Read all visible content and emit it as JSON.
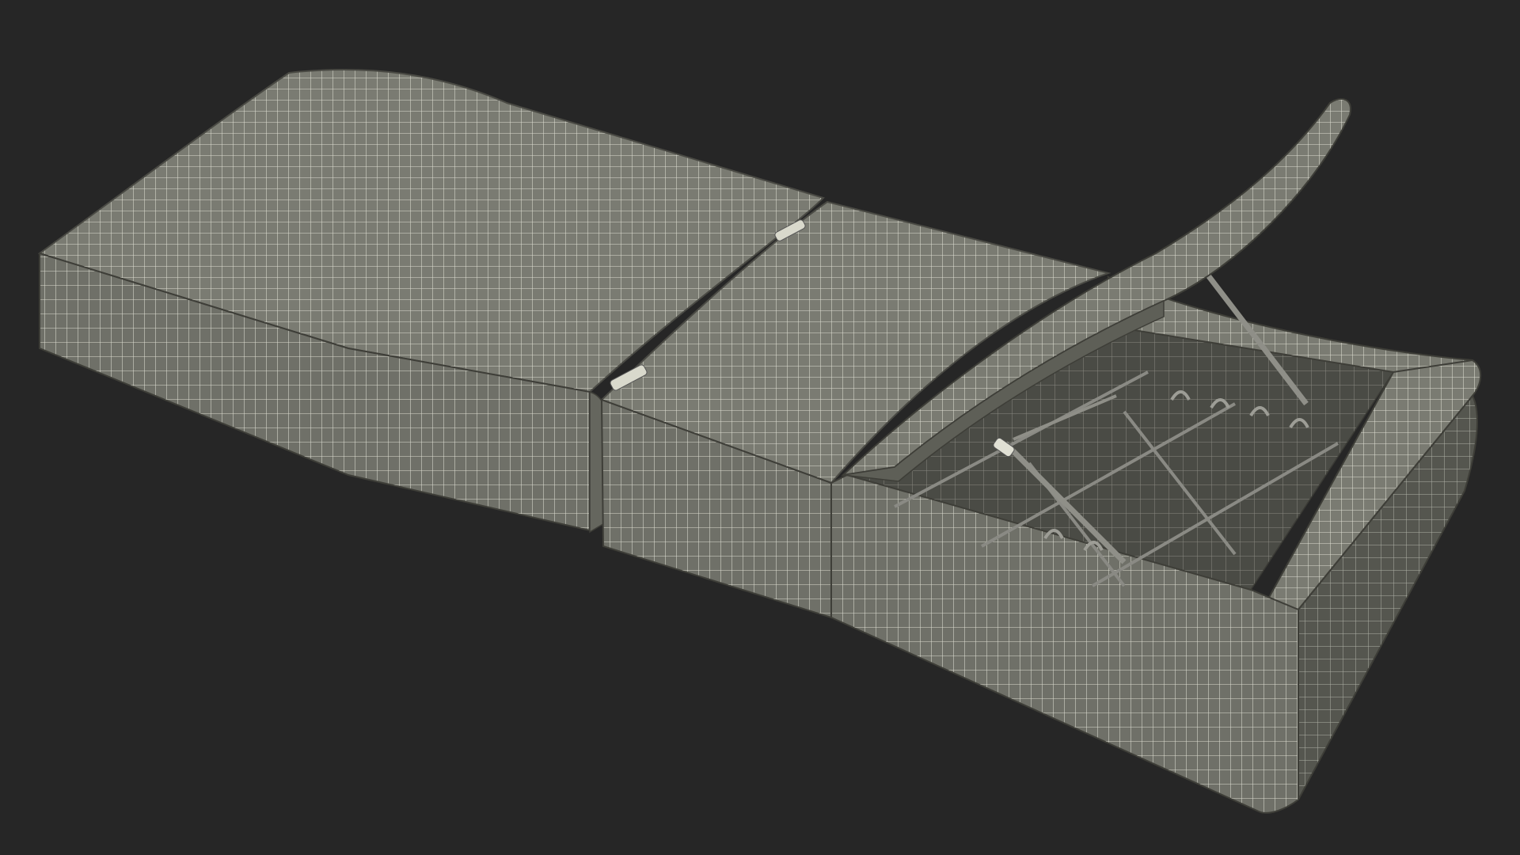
{
  "viewport": {
    "background": "#262626"
  },
  "model": {
    "fill": "#7a7b72",
    "fill_dark": "#5e5f57",
    "fill_inner": "#4b4c45",
    "wire": "#e8e8dc",
    "frame": "#8a8a84"
  }
}
